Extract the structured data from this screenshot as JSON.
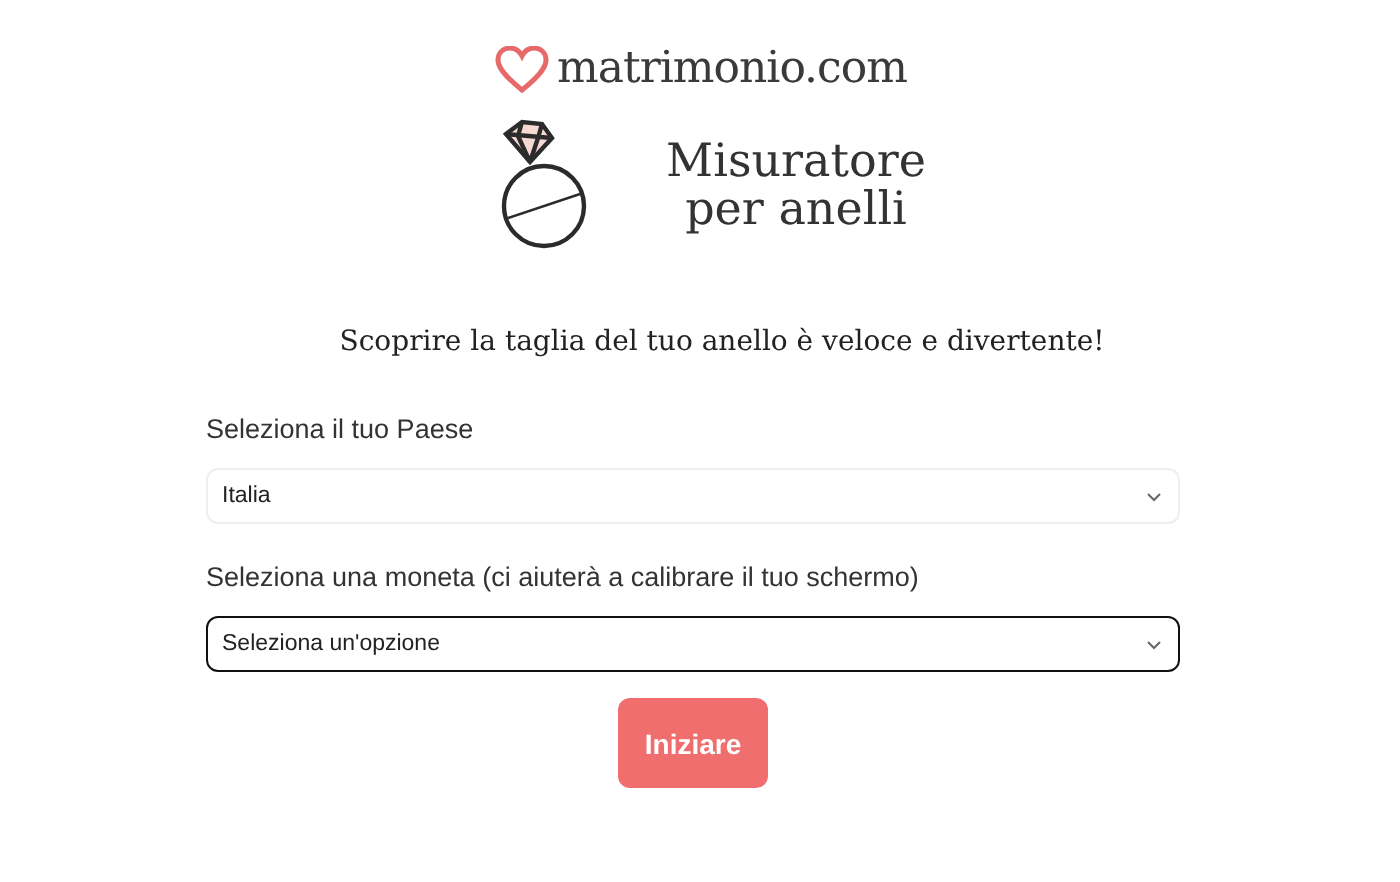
{
  "logo": {
    "text": "matrimonio.com"
  },
  "title": {
    "line_1": "Misuratore",
    "line_2": "per anelli"
  },
  "intro": "Scoprire la taglia del tuo anello è veloce e divertente!",
  "fields": [
    {
      "label": "Seleziona il tuo Paese",
      "value": "Italia",
      "focused": false
    },
    {
      "label": "Seleziona una moneta (ci aiuterà a calibrare il tuo schermo)",
      "placeholder": "Seleziona un'opzione",
      "focused": true
    }
  ],
  "button": {
    "label": "Iniziare"
  }
}
